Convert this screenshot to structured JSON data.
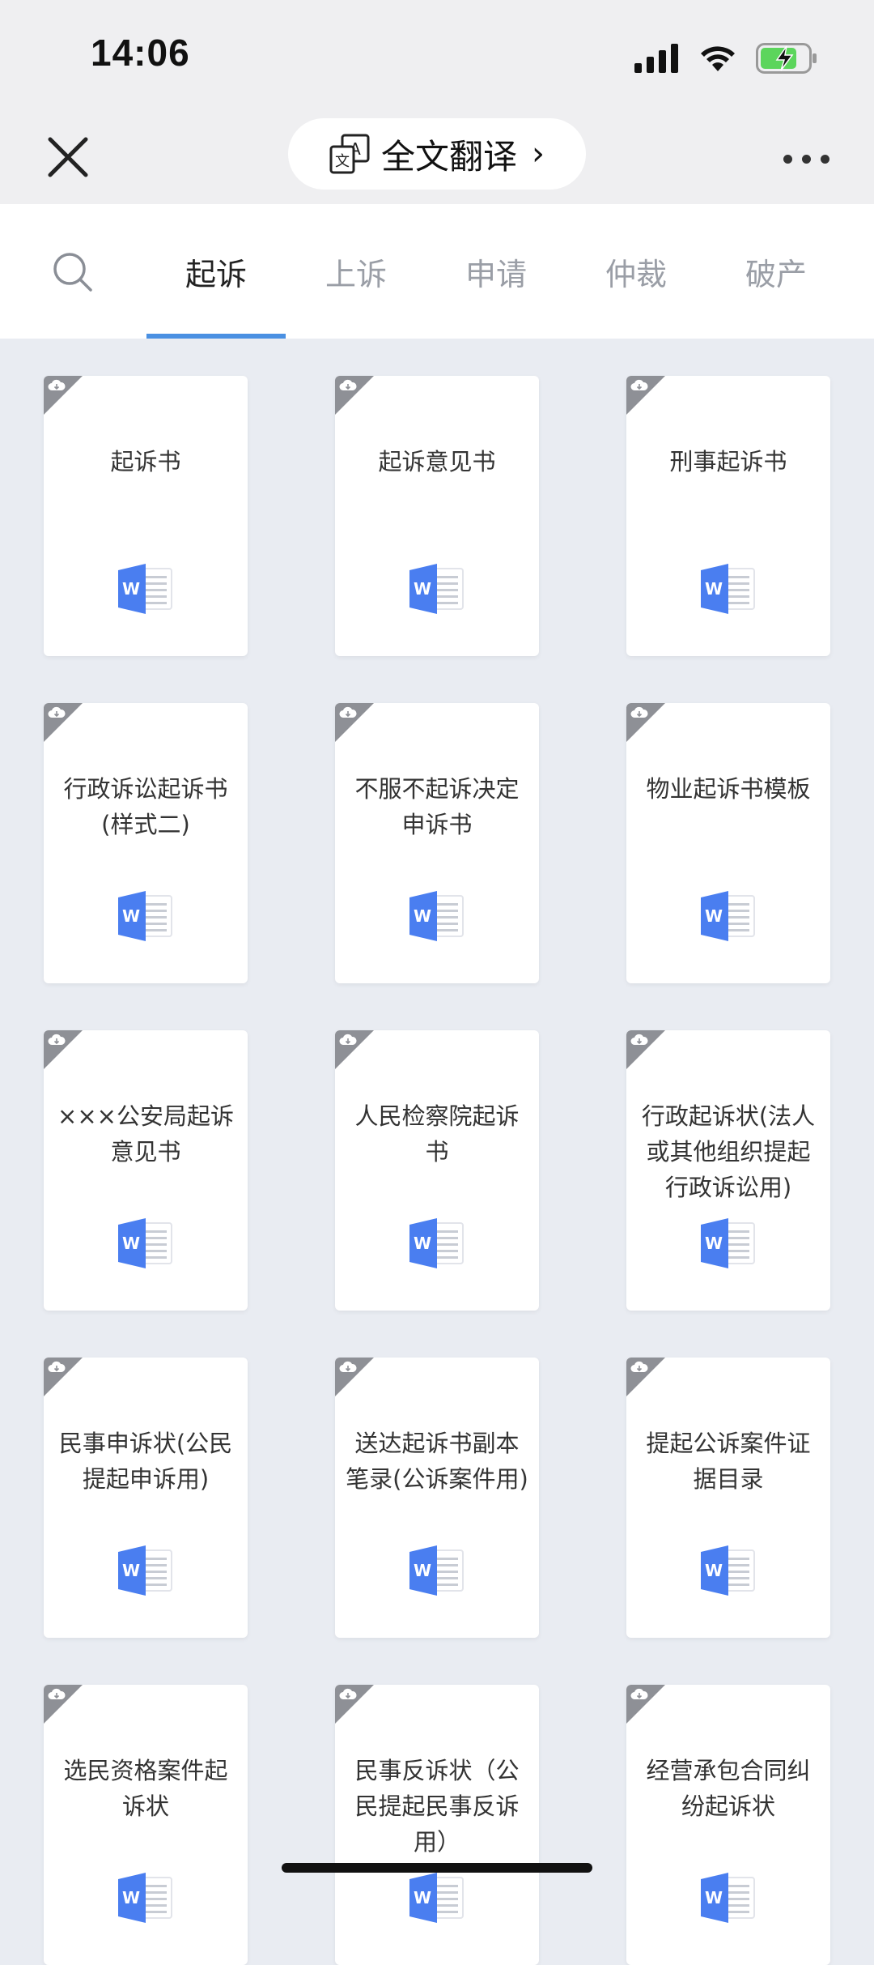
{
  "status_bar": {
    "time": "14:06"
  },
  "nav": {
    "translate_label": "全文翻译",
    "translate_chevron": "›"
  },
  "tabs": [
    {
      "label": "起诉",
      "active": true
    },
    {
      "label": "上诉",
      "active": false
    },
    {
      "label": "申请",
      "active": false
    },
    {
      "label": "仲裁",
      "active": false
    },
    {
      "label": "破产",
      "active": false
    }
  ],
  "documents": [
    "起诉书",
    "起诉意见书",
    "刑事起诉书",
    "行政诉讼起诉书(样式二)",
    "不服不起诉决定申诉书",
    "物业起诉书模板",
    "×××公安局起诉意见书",
    "人民检察院起诉书",
    "行政起诉状(法人或其他组织提起行政诉讼用)",
    "民事申诉状(公民提起申诉用)",
    "送达起诉书副本笔录(公诉案件用)",
    "提起公诉案件证据目录",
    "选民资格案件起诉状",
    "民事反诉状（公民提起民事反诉用）",
    "经营承包合同纠纷起诉状"
  ],
  "colors": {
    "accent": "#4a90e2",
    "word_blue": "#4a7ef0",
    "battery_green": "#5cd55c"
  }
}
